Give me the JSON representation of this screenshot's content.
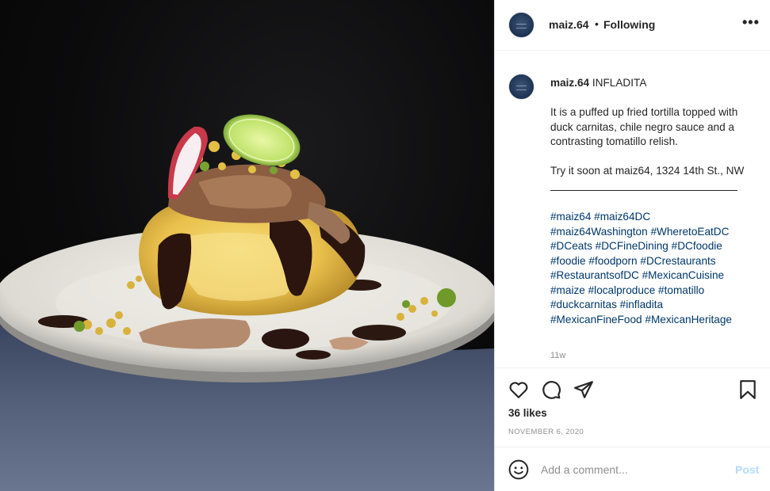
{
  "post": {
    "photo_alt": "Inflatida dish on a white plate",
    "colors": {
      "link": "#00376b",
      "post_disabled": "#b3dbff",
      "muted": "#8e8e8e"
    }
  },
  "header": {
    "username": "maiz.64",
    "separator": "•",
    "follow_status": "Following",
    "more_label": "•••"
  },
  "caption": {
    "username": "maiz.64",
    "title": "INFLADITA",
    "paragraph1": "It is a puffed up fried tortilla topped with duck carnitas, chile negro sauce and a contrasting tomatillo relish.",
    "paragraph2": "Try it soon at maiz64, 1324 14th St., NW",
    "hashtags": [
      "#maiz64",
      "#maiz64DC",
      "#maiz64Washington",
      "#WheretoEatDC",
      "#DCeats",
      "#DCFineDining",
      "#DCfoodie",
      "#foodie",
      "#foodporn",
      "#DCrestaurants",
      "#RestaurantsofDC",
      "#MexicanCuisine",
      "#maize",
      "#localproduce",
      "#tomatillo",
      "#duckcarnitas",
      "#infladita",
      "#MexicanFineFood",
      "#MexicanHeritage"
    ],
    "age": "11w"
  },
  "actions": {
    "icons": [
      "heart-icon",
      "comment-icon",
      "share-icon",
      "bookmark-icon"
    ],
    "likes": "36 likes",
    "date": "NOVEMBER 6, 2020"
  },
  "comment_box": {
    "placeholder": "Add a comment...",
    "post_label": "Post",
    "emoji_icon": "smiley-icon"
  }
}
